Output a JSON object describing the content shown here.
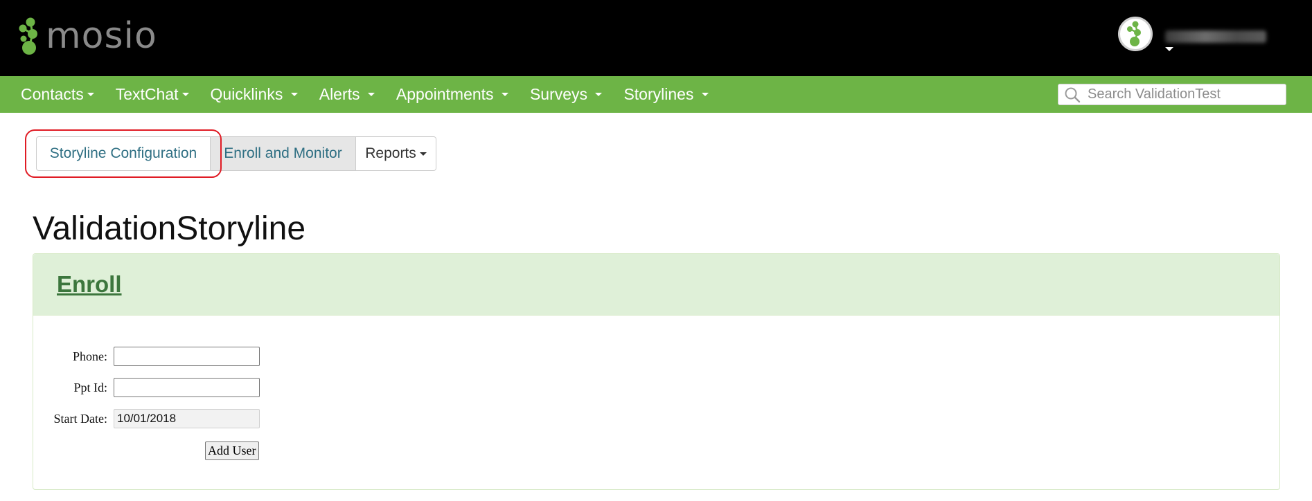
{
  "header": {
    "logo_text": "mosio",
    "colors": {
      "bar": "#000000",
      "logo_green": "#6db446",
      "logo_text": "#8a8a8a"
    }
  },
  "nav": {
    "items": [
      {
        "label": "Contacts"
      },
      {
        "label": "TextChat"
      },
      {
        "label": "Quicklinks"
      },
      {
        "label": "Alerts"
      },
      {
        "label": "Appointments"
      },
      {
        "label": "Surveys"
      },
      {
        "label": "Storylines"
      }
    ],
    "search": {
      "placeholder": "Search ValidationTest",
      "value": ""
    },
    "colors": {
      "bar": "#6db446"
    }
  },
  "tabs": {
    "config_label": "Storyline Configuration",
    "enroll_label": "Enroll and Monitor",
    "reports_label": "Reports"
  },
  "page": {
    "title": "ValidationStoryline"
  },
  "panel": {
    "heading": "Enroll",
    "fields": {
      "phone_label": "Phone:",
      "phone_value": "",
      "ppt_label": "Ppt Id:",
      "ppt_value": "",
      "start_label": "Start Date:",
      "start_value": "10/01/2018"
    },
    "submit_label": "Add User"
  }
}
